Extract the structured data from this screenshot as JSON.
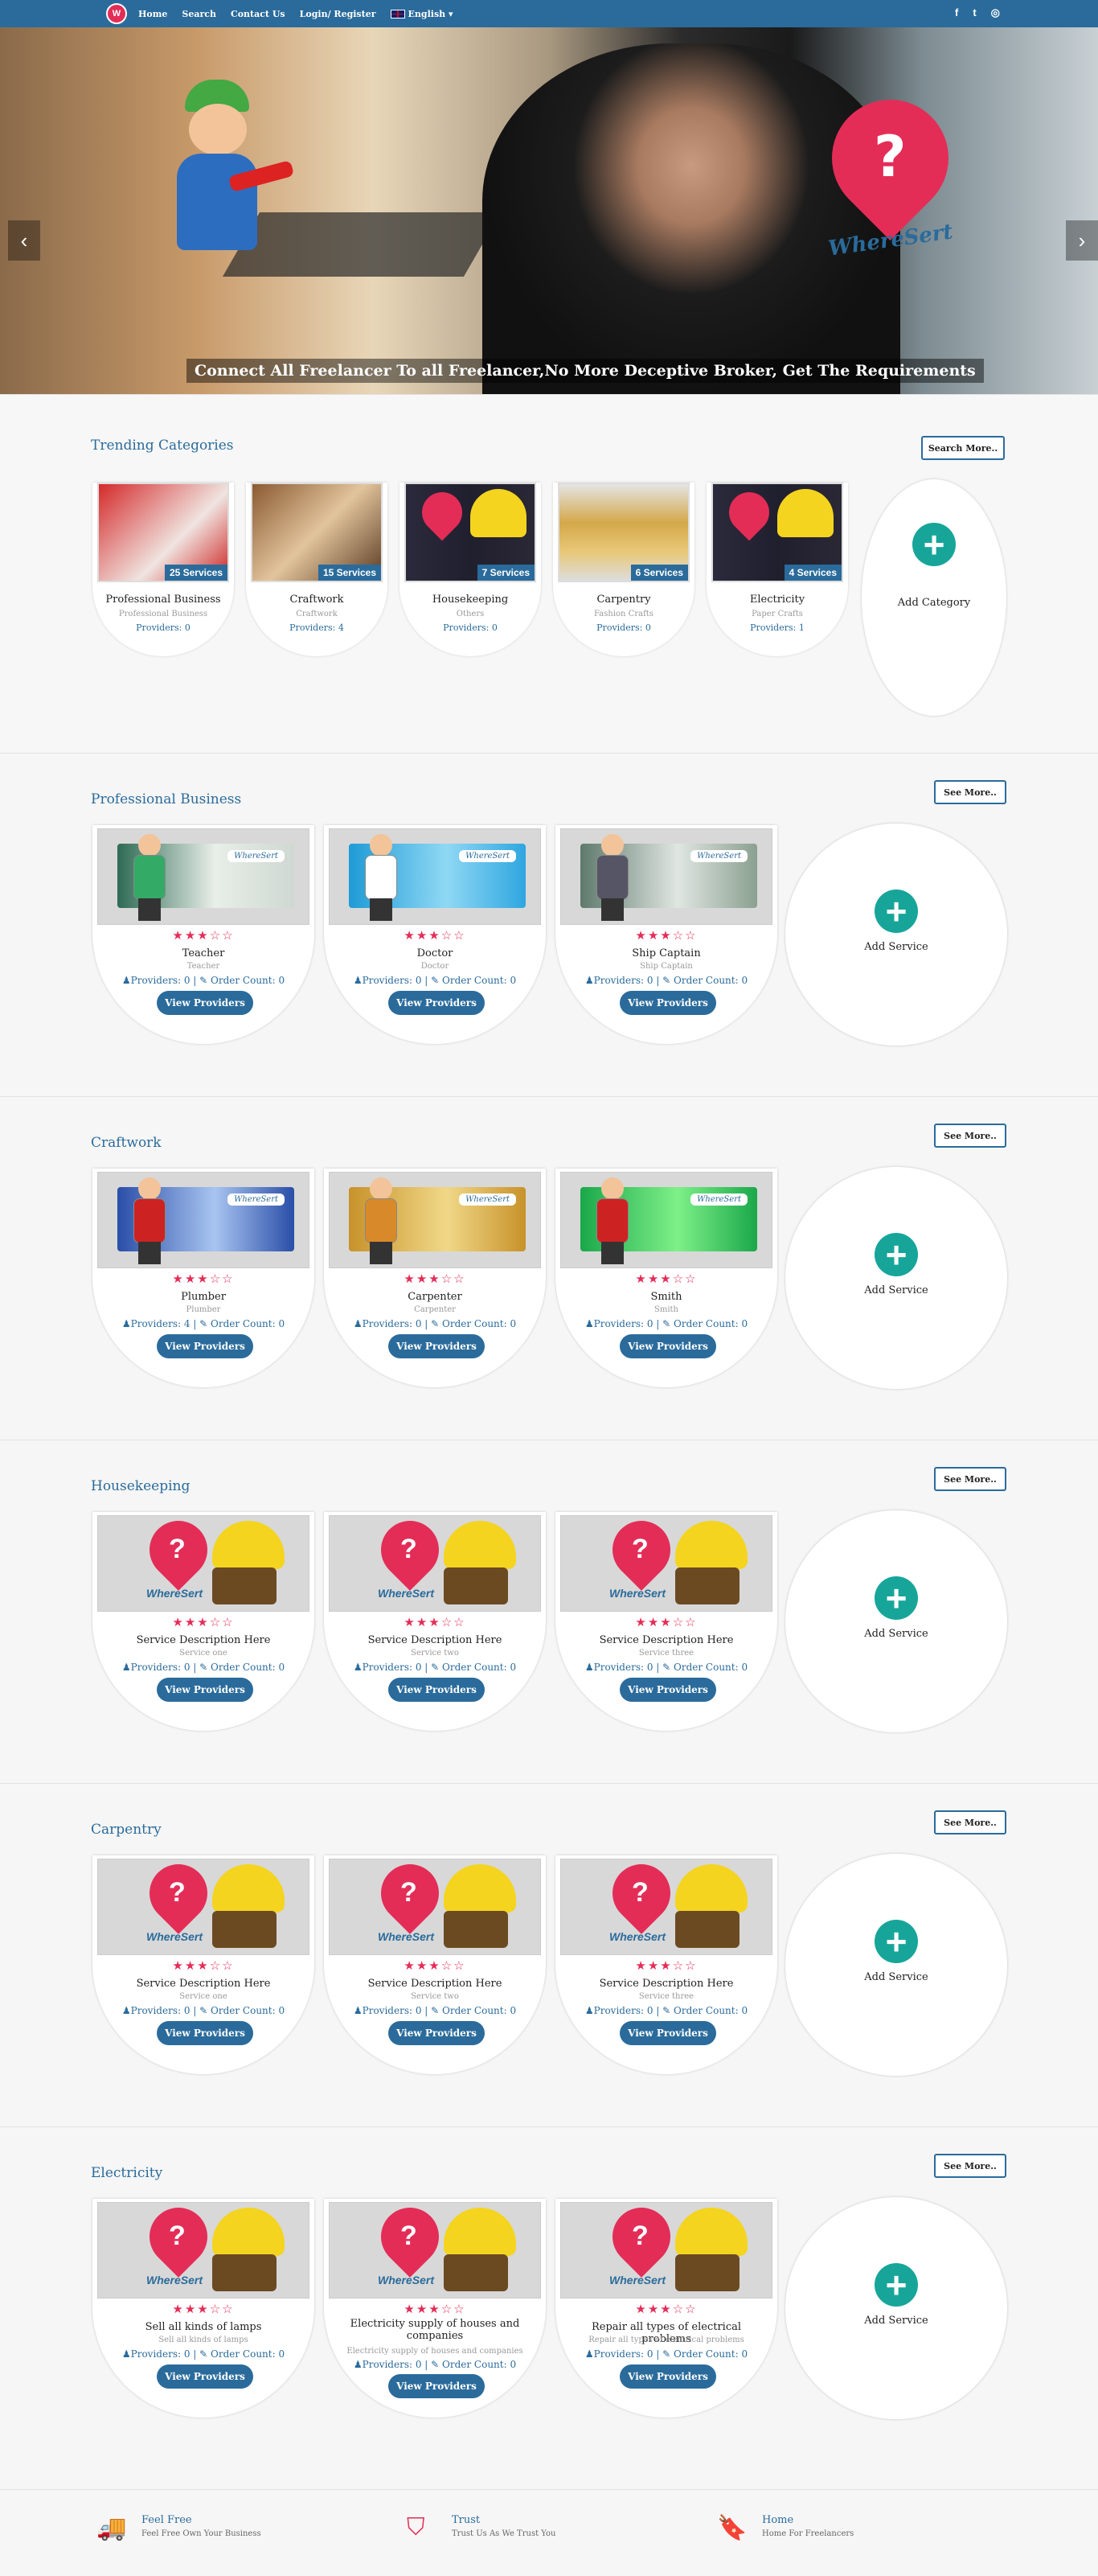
{
  "nav": {
    "logo": "W",
    "links": [
      "Home",
      "Search",
      "Contact Us",
      "Login/ Register"
    ],
    "language": "English ▾",
    "social": [
      "f",
      "t",
      "◎"
    ]
  },
  "hero": {
    "caption": "Connect All Freelancer To all Freelancer,No More Deceptive Broker, Get The Requirements",
    "brand": "WhereSert",
    "prev": "‹",
    "next": "›"
  },
  "trending": {
    "title": "Trending Categories",
    "button": "Search More..",
    "add_label": "Add Category",
    "categories": [
      {
        "count": "25 Services",
        "name": "Professional Business",
        "sub": "Professional Business",
        "providers": "Providers: 0"
      },
      {
        "count": "15 Services",
        "name": "Craftwork",
        "sub": "Craftwork",
        "providers": "Providers: 4"
      },
      {
        "count": "7 Services",
        "name": "Housekeeping",
        "sub": "Others",
        "providers": "Providers: 0"
      },
      {
        "count": "6 Services",
        "name": "Carpentry",
        "sub": "Fashion Crafts",
        "providers": "Providers: 0"
      },
      {
        "count": "4 Services",
        "name": "Electricity",
        "sub": "Paper Crafts",
        "providers": "Providers: 1"
      }
    ]
  },
  "common": {
    "see_more": "See More..",
    "add_service": "Add Service",
    "view_providers": "View Providers",
    "stars": "★★★☆☆",
    "wheresert": "WhereSert",
    "plus": "+"
  },
  "sections": [
    {
      "title": "Professional Business",
      "cards": [
        {
          "title": "Teacher",
          "sub": "Teacher",
          "meta": "♟Providers: 0 | ✎ Order Count: 0"
        },
        {
          "title": "Doctor",
          "sub": "Doctor",
          "meta": "♟Providers: 0 | ✎ Order Count: 0"
        },
        {
          "title": "Ship Captain",
          "sub": "Ship Captain",
          "meta": "♟Providers: 0 | ✎ Order Count: 0"
        }
      ]
    },
    {
      "title": "Craftwork",
      "cards": [
        {
          "title": "Plumber",
          "sub": "Plumber",
          "meta": "♟Providers: 4 | ✎ Order Count: 0"
        },
        {
          "title": "Carpenter",
          "sub": "Carpenter",
          "meta": "♟Providers: 0 | ✎ Order Count: 0"
        },
        {
          "title": "Smith",
          "sub": "Smith",
          "meta": "♟Providers: 0 | ✎ Order Count: 0"
        }
      ]
    },
    {
      "title": "Housekeeping",
      "cards": [
        {
          "title": "Service Description Here",
          "sub": "Service one",
          "meta": "♟Providers: 0 | ✎ Order Count: 0"
        },
        {
          "title": "Service Description Here",
          "sub": "Service two",
          "meta": "♟Providers: 0 | ✎ Order Count: 0"
        },
        {
          "title": "Service Description Here",
          "sub": "Service three",
          "meta": "♟Providers: 0 | ✎ Order Count: 0"
        }
      ]
    },
    {
      "title": "Carpentry",
      "cards": [
        {
          "title": "Service Description Here",
          "sub": "Service one",
          "meta": "♟Providers: 0 | ✎ Order Count: 0"
        },
        {
          "title": "Service Description Here",
          "sub": "Service two",
          "meta": "♟Providers: 0 | ✎ Order Count: 0"
        },
        {
          "title": "Service Description Here",
          "sub": "Service three",
          "meta": "♟Providers: 0 | ✎ Order Count: 0"
        }
      ]
    },
    {
      "title": "Electricity",
      "cards": [
        {
          "title": "Sell all kinds of lamps",
          "sub": "Sell all kinds of lamps",
          "meta": "♟Providers: 0 | ✎ Order Count: 0"
        },
        {
          "title": "Electricity supply of houses and companies",
          "sub": "Electricity supply of houses and companies",
          "meta": "♟Providers: 0 | ✎ Order Count: 0"
        },
        {
          "title": "Repair all types of electrical problems",
          "sub": "Repair all types of electrical problems",
          "meta": "♟Providers: 0 | ✎ Order Count: 0"
        }
      ]
    }
  ],
  "footer": {
    "features": [
      {
        "icon": "truck-icon",
        "glyph": "🚚",
        "title": "Feel Free",
        "desc": "Feel Free Own Your Business"
      },
      {
        "icon": "shield-icon",
        "glyph": "⛉",
        "title": "Trust",
        "desc": "Trust Us As We Trust You"
      },
      {
        "icon": "bookmark-icon",
        "glyph": "🔖",
        "title": "Home",
        "desc": "Home For Freelancers"
      }
    ]
  },
  "colors": {
    "primary": "#2a6b9b",
    "accent": "#e32d57",
    "teal": "#17a59a"
  }
}
